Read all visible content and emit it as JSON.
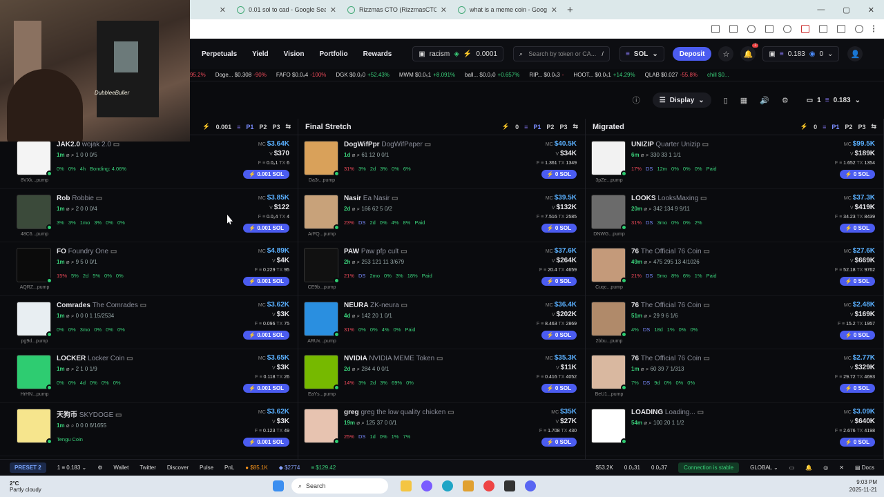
{
  "browser": {
    "tabs": [
      {
        "title": "0.01 sol to cad - Google Search"
      },
      {
        "title": "Rizzmas CTO (RizzmasCTO) - P..."
      },
      {
        "title": "what is a meme coin - Google S..."
      }
    ],
    "new_tab": "+"
  },
  "webcam": {
    "logo_text": "DubbleeBuller"
  },
  "nav": {
    "items": [
      "Perpetuals",
      "Yield",
      "Vision",
      "Portfolio",
      "Rewards"
    ],
    "wallet_name": "racism",
    "wallet_value": "0.0001",
    "search_placeholder": "Search by token or CA...",
    "search_hint": "/",
    "chain": "SOL",
    "deposit": "Deposit",
    "notif_count": "1",
    "balance": "0.183",
    "tokens": "0"
  },
  "ticker": [
    {
      "text": "95.2%",
      "cls": "dn"
    },
    {
      "text": "Doge... $0.308",
      "chg": "-90%",
      "cls": "dn"
    },
    {
      "text": "FAFO $0.0₄4",
      "chg": "-100%",
      "cls": "dn"
    },
    {
      "text": "DGK $0.0₂0",
      "chg": "+52.43%",
      "cls": "up"
    },
    {
      "text": "MWM $0.0₅1",
      "chg": "+8.091%",
      "cls": "up"
    },
    {
      "text": "ball... $0.0₂0",
      "chg": "+0.657%",
      "cls": "up"
    },
    {
      "text": "RIP... $0.0₅3",
      "chg": "-",
      "cls": "dn"
    },
    {
      "text": "HOOT... $0.0₅1",
      "chg": "+14.29%",
      "cls": "up"
    },
    {
      "text": "QLAB $0.027",
      "chg": "-55.8%",
      "cls": "dn"
    },
    {
      "text": "chill $0...",
      "chg": "",
      "cls": "up"
    }
  ],
  "subbar": {
    "display": "Display",
    "count": "1",
    "balance": "0.183"
  },
  "columns": [
    {
      "title": "",
      "amount": "0.001",
      "presets": [
        "P1",
        "P2",
        "P3"
      ],
      "cards": [
        {
          "ticker": "JAK2.0",
          "full": "wojak 2.0",
          "age": "1m",
          "meta": "1  0  0  0/5",
          "stats": [
            "0%",
            "0%",
            "4h",
            "Bonding: 4.06%"
          ],
          "mc": "$3.64K",
          "v": "$370",
          "f": "0.0₂1",
          "tx": "6",
          "buy": "0.001 SOL",
          "short": "8VXk...pump",
          "color": "#f4f4f4"
        },
        {
          "ticker": "Rob",
          "full": "Robbie",
          "age": "1m",
          "meta": "2  0  0  0/4",
          "stats": [
            "3%",
            "3%",
            "1mo",
            "3%",
            "0%",
            "0%"
          ],
          "mc": "$3.85K",
          "v": "$122",
          "f": "0.0₂4",
          "tx": "4",
          "buy": "0.001 SOL",
          "short": "48C6...pump",
          "color": "#3b4a3a"
        },
        {
          "ticker": "FO",
          "full": "Foundry One",
          "age": "1m",
          "meta": "9  5  0  0/1",
          "stats": [
            "15%",
            "5%",
            "2d",
            "5%",
            "0%",
            "0%"
          ],
          "mc": "$4.89K",
          "v": "$4K",
          "f": "0.229",
          "tx": "95",
          "buy": "0.001 SOL",
          "short": "AQRZ...pump",
          "color": "#0b0b0b"
        },
        {
          "ticker": "Comrades",
          "full": "The Comrades",
          "age": "1m",
          "meta": "0  0  0  1  15/2534",
          "stats": [
            "0%",
            "0%",
            "3mo",
            "0%",
            "0%",
            "0%"
          ],
          "mc": "$3.62K",
          "v": "$3K",
          "f": "0.096",
          "tx": "75",
          "buy": "0.001 SOL",
          "short": "pg9d...pump",
          "color": "#e8eef2"
        },
        {
          "ticker": "LOCKER",
          "full": "Locker Coin",
          "age": "1m",
          "meta": "2  1  0  1/9",
          "stats": [
            "0%",
            "0%",
            "4d",
            "0%",
            "0%",
            "0%"
          ],
          "mc": "$3.65K",
          "v": "$3K",
          "f": "0.118",
          "tx": "26",
          "buy": "0.001 SOL",
          "short": "HrHN...pump",
          "color": "#2ecc71"
        },
        {
          "ticker": "天狗币",
          "full": "SKYDOGE",
          "age": "1m",
          "meta": "0  0  0  6/1655",
          "stats": [
            "Tengu Coin"
          ],
          "mc": "$3.62K",
          "v": "$3K",
          "f": "0.123",
          "tx": "49",
          "buy": "0.001 SOL",
          "short": "",
          "color": "#f6e58d"
        }
      ]
    },
    {
      "title": "Final Stretch",
      "amount": "0",
      "presets": [
        "P1",
        "P2",
        "P3"
      ],
      "cards": [
        {
          "ticker": "DogWifPpr",
          "full": "DogWifPaper",
          "age": "1d",
          "meta": "61  12  0  0/1",
          "stats": [
            "31%",
            "3%",
            "2d",
            "3%",
            "0%",
            "6%"
          ],
          "mc": "$40.5K",
          "v": "$34K",
          "f": "1.361",
          "tx": "1349",
          "buy": "0 SOL",
          "short": "Da3r...pump",
          "color": "#d9a15a"
        },
        {
          "ticker": "Nasir",
          "full": "Ea Nasir",
          "age": "2d",
          "meta": "166  62  5  0/2",
          "stats": [
            "23%",
            "DS",
            "2d",
            "0%",
            "4%",
            "8%",
            "Paid"
          ],
          "mc": "$39.5K",
          "v": "$132K",
          "f": "7.516",
          "tx": "2585",
          "buy": "0 SOL",
          "short": "ArFQ...pump",
          "color": "#c8a27a"
        },
        {
          "ticker": "PAW",
          "full": "Paw pfp cult",
          "age": "2h",
          "meta": "253  121  11  3/679",
          "stats": [
            "21%",
            "DS",
            "2mo",
            "0%",
            "3%",
            "18%",
            "Paid"
          ],
          "mc": "$37.6K",
          "v": "$264K",
          "f": "20.4",
          "tx": "4659",
          "buy": "0 SOL",
          "short": "CE9b...pump",
          "color": "#111"
        },
        {
          "ticker": "NEURA",
          "full": "ZK-neura",
          "age": "4d",
          "meta": "142  20  1  0/1",
          "stats": [
            "31%",
            "0%",
            "0%",
            "4%",
            "0%",
            "Paid"
          ],
          "mc": "$36.4K",
          "v": "$202K",
          "f": "8.463",
          "tx": "2869",
          "buy": "0 SOL",
          "short": "ARUx...pump",
          "color": "#2a8fe0"
        },
        {
          "ticker": "NVIDIA",
          "full": "NVIDIA MEME Token",
          "age": "2d",
          "meta": "284  4  0  0/1",
          "stats": [
            "14%",
            "3%",
            "2d",
            "3%",
            "69%",
            "0%"
          ],
          "mc": "$35.3K",
          "v": "$11K",
          "f": "0.416",
          "tx": "4052",
          "buy": "0 SOL",
          "short": "EaYs...pump",
          "color": "#76b900"
        },
        {
          "ticker": "greg",
          "full": "greg the low quality chicken",
          "age": "19m",
          "meta": "125  37  0  0/1",
          "stats": [
            "25%",
            "DS",
            "1d",
            "0%",
            "1%",
            "7%"
          ],
          "mc": "$35K",
          "v": "$27K",
          "f": "1.708",
          "tx": "430",
          "buy": "0 SOL",
          "short": "",
          "color": "#e7c3b0"
        }
      ]
    },
    {
      "title": "Migrated",
      "amount": "0",
      "presets": [
        "P1",
        "P2",
        "P3"
      ],
      "cards": [
        {
          "ticker": "UNIZIP",
          "full": "Quarter Unizip",
          "age": "6m",
          "meta": "330  33  1  1/1",
          "stats": [
            "17%",
            "DS",
            "12m",
            "0%",
            "0%",
            "0%",
            "Paid"
          ],
          "mc": "$99.5K",
          "v": "$189K",
          "f": "1.652",
          "tx": "1354",
          "buy": "0 SOL",
          "short": "3pZe...pump",
          "color": "#f2f2f2"
        },
        {
          "ticker": "LOOKS",
          "full": "LooksMaxing",
          "age": "20m",
          "meta": "342  134  9  9/11",
          "stats": [
            "31%",
            "DS",
            "3mo",
            "0%",
            "0%",
            "2%"
          ],
          "mc": "$37.3K",
          "v": "$419K",
          "f": "34.23",
          "tx": "8439",
          "buy": "0 SOL",
          "short": "DNWG...pump",
          "color": "#6b6b6b"
        },
        {
          "ticker": "76",
          "full": "The Official 76 Coin",
          "age": "49m",
          "meta": "475  295  13  4/1026",
          "stats": [
            "21%",
            "DS",
            "5mo",
            "8%",
            "6%",
            "1%",
            "Paid"
          ],
          "mc": "$27.6K",
          "v": "$669K",
          "f": "52.18",
          "tx": "9762",
          "buy": "0 SOL",
          "short": "Cuqc...pump",
          "color": "#c49a7a"
        },
        {
          "ticker": "76",
          "full": "The Official 76 Coin",
          "age": "51m",
          "meta": "29  9  6  1/6",
          "stats": [
            "4%",
            "DS",
            "18d",
            "1%",
            "0%",
            "0%"
          ],
          "mc": "$2.48K",
          "v": "$169K",
          "f": "15.2",
          "tx": "1957",
          "buy": "0 SOL",
          "short": "2bbu...pump",
          "color": "#b08a6a"
        },
        {
          "ticker": "76",
          "full": "The Official 76 Coin",
          "age": "1m",
          "meta": "60  39  7  1/313",
          "stats": [
            "7%",
            "DS",
            "9d",
            "0%",
            "0%",
            "0%"
          ],
          "mc": "$2.77K",
          "v": "$329K",
          "f": "29.72",
          "tx": "4693",
          "buy": "0 SOL",
          "short": "BeU1...pump",
          "color": "#d9b8a0"
        },
        {
          "ticker": "LOADING",
          "full": "Loading...",
          "age": "54m",
          "meta": "100  20  1  1/2",
          "stats": [],
          "mc": "$3.09K",
          "v": "$640K",
          "f": "2.676",
          "tx": "4198",
          "buy": "0 SOL",
          "short": "",
          "color": "#fff"
        }
      ]
    }
  ],
  "bottom": {
    "preset": "PRESET 2",
    "count": "1",
    "balance": "0.183",
    "links": [
      "Wallet",
      "Twitter",
      "Discover",
      "Pulse",
      "PnL"
    ],
    "btc": "$85.1K",
    "eth": "$2774",
    "sol": "$129.42",
    "mc": "$53.2K",
    "gas1": "0.0₂31",
    "gas2": "0.0₂37",
    "connection": "Connection is stable",
    "region": "GLOBAL",
    "docs": "Docs"
  },
  "taskbar": {
    "temp": "2°C",
    "weather": "Partly cloudy",
    "search": "Search",
    "time": "9:03 PM",
    "date": "2025-11-21"
  }
}
